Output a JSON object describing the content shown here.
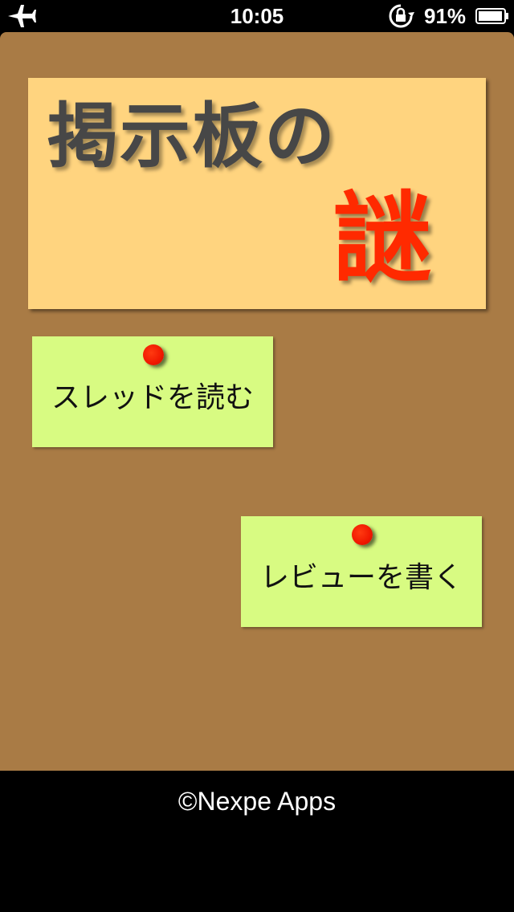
{
  "status_bar": {
    "time": "10:05",
    "battery_percent": "91%",
    "icons": [
      "airplane-icon",
      "rotation-lock-icon",
      "battery-icon"
    ]
  },
  "title": {
    "main": "掲示板の",
    "accent": "謎"
  },
  "buttons": {
    "read_thread": "スレッドを読む",
    "write_review": "レビューを書く"
  },
  "footer": {
    "copyright": "©Nexpe Apps"
  },
  "colors": {
    "board": "#a97b45",
    "title_note": "#ffd47f",
    "sticky_note": "#d8fb82",
    "pin": "#f01800",
    "accent_text": "#ff2a00",
    "title_text": "#474747"
  }
}
